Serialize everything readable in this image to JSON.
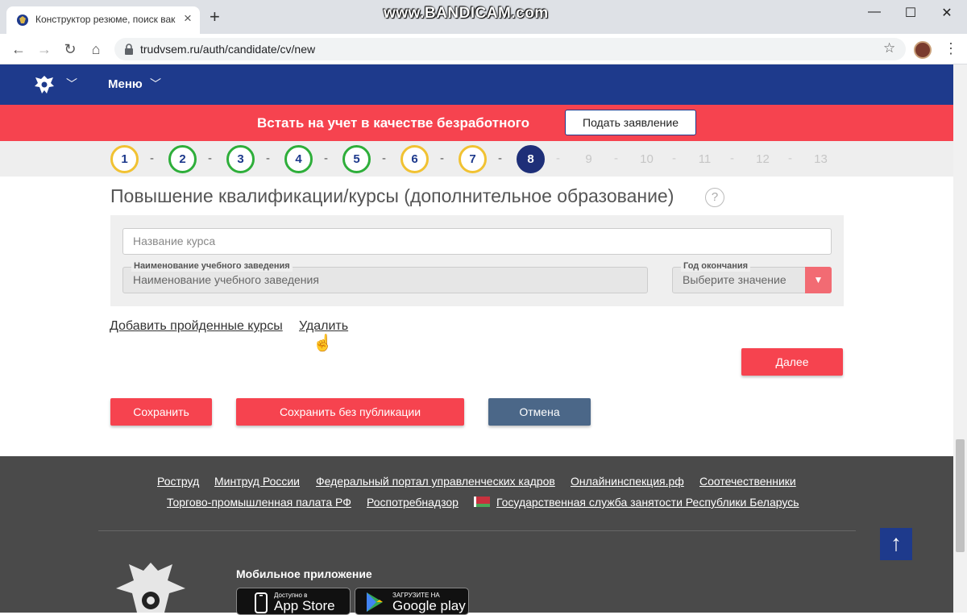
{
  "browser": {
    "tab_title": "Конструктор резюме, поиск вак",
    "url": "trudvsem.ru/auth/candidate/cv/new",
    "watermark": "www.BANDICAM.com"
  },
  "nav": {
    "menu_label": "Меню"
  },
  "banner": {
    "text": "Встать на учет в качестве безработного",
    "button_label": "Подать заявление"
  },
  "steps": {
    "labels": [
      "1",
      "2",
      "3",
      "4",
      "5",
      "6",
      "7",
      "8",
      "9",
      "10",
      "11",
      "12",
      "13"
    ],
    "current": 8,
    "separator": "-"
  },
  "section": {
    "title": "Повышение квалификации/курсы (дополнительное образование)",
    "help": "?",
    "course_placeholder": "Название курса",
    "institution_label": "Наименование учебного заведения",
    "institution_placeholder": "Наименование учебного заведения",
    "year_label": "Год окончания",
    "year_value": "Выберите значение"
  },
  "links": {
    "add": "Добавить пройденные курсы",
    "delete": "Удалить"
  },
  "buttons": {
    "next": "Далее",
    "save": "Сохранить",
    "save_no_publish": "Сохранить без публикации",
    "cancel": "Отмена"
  },
  "footer": {
    "links_row1": [
      "Роструд",
      "Минтруд России",
      "Федеральный портал управленческих кадров",
      "Онлайнинспекция.рф",
      "Соотечественники"
    ],
    "links_row2": [
      "Торгово-промышленная палата РФ",
      "Роспотребнадзор",
      "Государственная служба занятости Республики Беларусь"
    ],
    "app_title": "Мобильное приложение",
    "appstore_small": "Доступно в",
    "appstore_big": "App Store",
    "googleplay_small": "ЗАГРУЗИТЕ НА",
    "googleplay_big": "Google play"
  },
  "colors": {
    "nav_blue": "#1e3a8c",
    "accent_red": "#f6434f",
    "done_green": "#2eae3a",
    "warn_yellow": "#f1c232",
    "footer_gray": "#4a4a4a"
  }
}
